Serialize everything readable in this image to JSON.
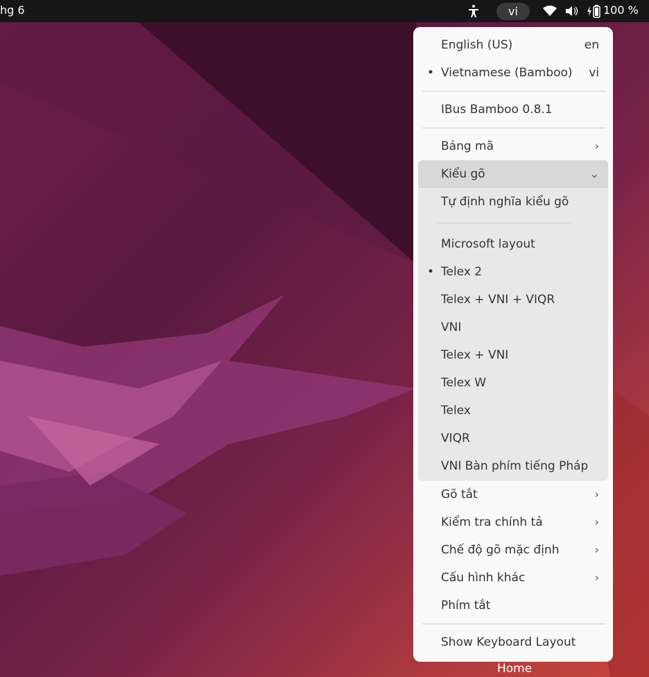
{
  "topbar": {
    "clock": "hg 6",
    "input_method": "vi",
    "battery": "100 %"
  },
  "dock": {
    "home_label": "Home"
  },
  "menu": {
    "languages": [
      {
        "label": "English (US)",
        "code": "en",
        "selected": false
      },
      {
        "label": "Vietnamese (Bamboo)",
        "code": "vi",
        "selected": true
      }
    ],
    "engine": "IBus Bamboo 0.8.1",
    "bang_ma": "Bảng mã",
    "kieu_go": {
      "label": "Kiểu gõ",
      "custom": "Tự định nghĩa kiểu gõ",
      "options": [
        {
          "label": "Microsoft layout",
          "selected": false
        },
        {
          "label": "Telex 2",
          "selected": true
        },
        {
          "label": "Telex + VNI + VIQR",
          "selected": false
        },
        {
          "label": "VNI",
          "selected": false
        },
        {
          "label": "Telex + VNI",
          "selected": false
        },
        {
          "label": "Telex W",
          "selected": false
        },
        {
          "label": "Telex",
          "selected": false
        },
        {
          "label": "VIQR",
          "selected": false
        },
        {
          "label": "VNI Bàn phím tiếng Pháp",
          "selected": false
        }
      ]
    },
    "submenus": [
      "Gõ tắt",
      "Kiểm tra chính tả",
      "Chế độ gõ mặc định",
      "Cấu hình khác"
    ],
    "phim_tat": "Phím tắt",
    "show_layout": "Show Keyboard Layout",
    "bullet": "•",
    "chevron_right": "›",
    "chevron_down": "⌄"
  }
}
